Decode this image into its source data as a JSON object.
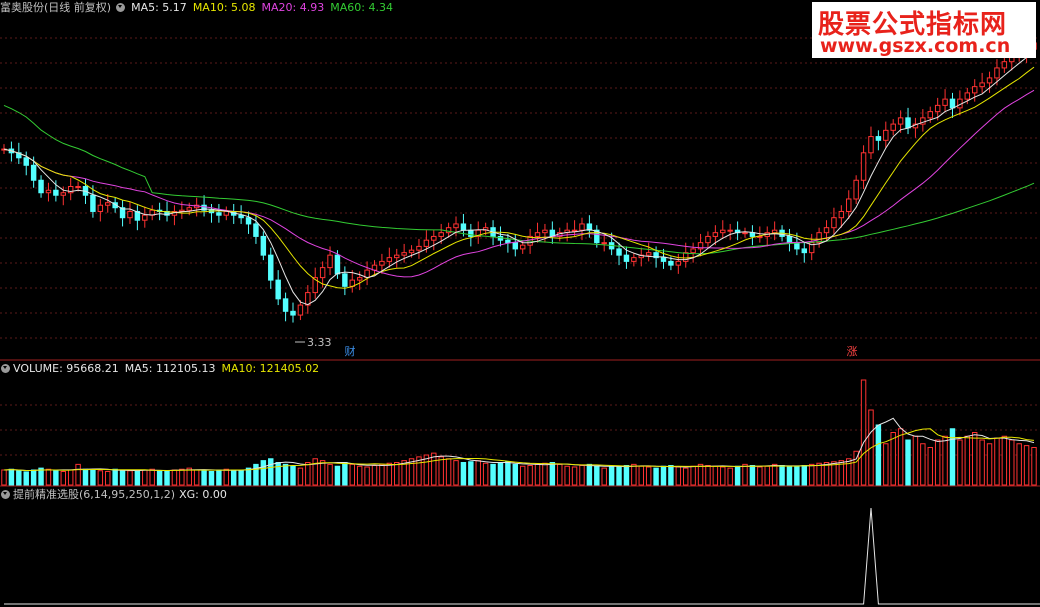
{
  "price_panel": {
    "title": "富奥股份(日线 前复权)",
    "legend": [
      {
        "label": "MA5: 5.17",
        "color": "#e6e6e6"
      },
      {
        "label": "MA10: 5.08",
        "color": "#e6e600"
      },
      {
        "label": "MA20: 4.93",
        "color": "#e044e0"
      },
      {
        "label": "MA60: 4.34",
        "color": "#33cc33"
      }
    ],
    "low_label": "3.33",
    "markers": [
      {
        "text": "财",
        "color": "#3b8ee8"
      },
      {
        "text": "涨",
        "color": "#ff4444"
      }
    ]
  },
  "volume_panel": {
    "legend": [
      {
        "label": "VOLUME: 95668.21",
        "color": "#e6e6e6"
      },
      {
        "label": "MA5: 112105.13",
        "color": "#e6e6e6"
      },
      {
        "label": "MA10: 121405.02",
        "color": "#e6e600"
      }
    ]
  },
  "signal_panel": {
    "legend": [
      {
        "label": "提前精准选股(6,14,95,250,1,2)",
        "color": "#c0c0c0"
      },
      {
        "label": "XG: 0.00",
        "color": "#e6e6e6"
      }
    ]
  },
  "watermark": {
    "line1": "股票公式指标网",
    "line2": "www.gszx.com.cn"
  },
  "chart_data": [
    {
      "type": "candlestick",
      "ylim": [
        3.1,
        5.8
      ],
      "low_annotation": 3.33,
      "ma_last": {
        "MA5": 5.17,
        "MA10": 5.08,
        "MA20": 4.93,
        "MA60": 4.34
      },
      "close": [
        4.75,
        4.72,
        4.68,
        4.62,
        4.5,
        4.4,
        4.42,
        4.38,
        4.4,
        4.45,
        4.45,
        4.38,
        4.25,
        4.3,
        4.32,
        4.28,
        4.2,
        4.25,
        4.18,
        4.22,
        4.26,
        4.25,
        4.22,
        4.25,
        4.26,
        4.28,
        4.3,
        4.26,
        4.24,
        4.22,
        4.25,
        4.22,
        4.2,
        4.15,
        4.05,
        3.9,
        3.7,
        3.55,
        3.45,
        3.42,
        3.5,
        3.6,
        3.72,
        3.8,
        3.9,
        3.75,
        3.65,
        3.7,
        3.72,
        3.78,
        3.82,
        3.85,
        3.88,
        3.9,
        3.92,
        3.94,
        3.97,
        4.02,
        4.05,
        4.08,
        4.12,
        4.15,
        4.1,
        4.05,
        4.1,
        4.12,
        4.05,
        4.02,
        4.0,
        3.95,
        3.98,
        4.05,
        4.08,
        4.1,
        4.05,
        4.08,
        4.1,
        4.1,
        4.15,
        4.1,
        4.0,
        4.0,
        3.95,
        3.9,
        3.85,
        3.88,
        3.9,
        3.92,
        3.88,
        3.85,
        3.82,
        3.85,
        3.92,
        3.95,
        4.0,
        4.05,
        4.08,
        4.1,
        4.1,
        4.08,
        4.08,
        4.05,
        4.05,
        4.08,
        4.1,
        4.05,
        4.0,
        3.95,
        3.92,
        4.0,
        4.08,
        4.12,
        4.2,
        4.25,
        4.35,
        4.5,
        4.72,
        4.85,
        4.82,
        4.9,
        4.95,
        5.0,
        4.92,
        4.95,
        5.0,
        5.05,
        5.1,
        5.15,
        5.08,
        5.15,
        5.2,
        5.25,
        5.28,
        5.32,
        5.4,
        5.45,
        5.5,
        5.52,
        5.55,
        5.6
      ]
    },
    {
      "type": "bar",
      "title": "VOLUME",
      "values": [
        40,
        42,
        38,
        35,
        40,
        45,
        42,
        38,
        36,
        40,
        55,
        42,
        40,
        38,
        36,
        42,
        40,
        38,
        36,
        40,
        42,
        38,
        36,
        40,
        42,
        45,
        40,
        38,
        36,
        40,
        42,
        40,
        38,
        45,
        55,
        65,
        70,
        60,
        55,
        50,
        45,
        60,
        70,
        65,
        55,
        50,
        60,
        55,
        50,
        48,
        52,
        55,
        58,
        60,
        65,
        70,
        75,
        80,
        85,
        75,
        70,
        65,
        60,
        62,
        65,
        58,
        55,
        60,
        62,
        55,
        50,
        52,
        55,
        58,
        60,
        55,
        50,
        48,
        52,
        55,
        50,
        45,
        48,
        50,
        52,
        55,
        50,
        48,
        45,
        50,
        52,
        48,
        45,
        50,
        55,
        52,
        50,
        48,
        45,
        50,
        55,
        52,
        48,
        50,
        55,
        52,
        50,
        48,
        52,
        55,
        58,
        60,
        62,
        65,
        70,
        90,
        280,
        200,
        160,
        110,
        140,
        150,
        120,
        130,
        110,
        100,
        120,
        130,
        150,
        120,
        130,
        140,
        120,
        110,
        125,
        130,
        120,
        110,
        105,
        100
      ]
    },
    {
      "type": "line",
      "title": "XG",
      "values": [
        0,
        0,
        0,
        0,
        0,
        0,
        0,
        0,
        0,
        0,
        0,
        0,
        0,
        0,
        0,
        0,
        0,
        0,
        0,
        0,
        0,
        0,
        0,
        0,
        0,
        0,
        0,
        0,
        0,
        0,
        0,
        0,
        0,
        0,
        0,
        0,
        0,
        0,
        0,
        0,
        0,
        0,
        0,
        0,
        0,
        0,
        0,
        0,
        0,
        0,
        0,
        0,
        0,
        0,
        0,
        0,
        0,
        0,
        0,
        0,
        0,
        0,
        0,
        0,
        0,
        0,
        0,
        0,
        0,
        0,
        0,
        0,
        0,
        0,
        0,
        0,
        0,
        0,
        0,
        0,
        0,
        0,
        0,
        0,
        0,
        0,
        0,
        0,
        0,
        0,
        0,
        0,
        0,
        0,
        0,
        0,
        0,
        0,
        0,
        0,
        0,
        0,
        0,
        0,
        0,
        0,
        0,
        0,
        0,
        0,
        0,
        0,
        0,
        0,
        0,
        0,
        0,
        1,
        0,
        0,
        0,
        0,
        0,
        0,
        0,
        0,
        0,
        0,
        0,
        0,
        0,
        0,
        0,
        0,
        0,
        0,
        0,
        0,
        0,
        0,
        0
      ]
    }
  ]
}
